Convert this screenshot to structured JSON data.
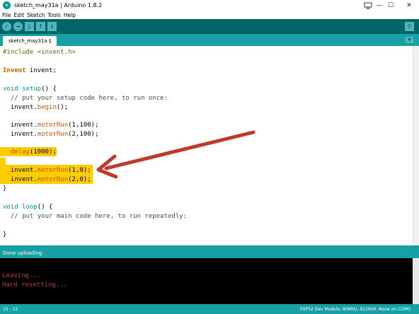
{
  "window": {
    "title": "sketch_may31a | Arduino 1.8.2",
    "minimize_glyph": "—",
    "maximize_glyph": "☐",
    "close_glyph": "✕",
    "logo_text": "∞"
  },
  "menu": [
    "File",
    "Edit",
    "Sketch",
    "Tools",
    "Help"
  ],
  "toolbar": {
    "verify_glyph": "✓",
    "upload_glyph": "→",
    "new_glyph": "▯",
    "open_glyph": "↑",
    "save_glyph": "↓",
    "serial_glyph": "⚲"
  },
  "tab": {
    "label": "sketch_may31a §",
    "menu_glyph": "▼"
  },
  "code": {
    "l1a": "#include ",
    "l1b": "<invent.h>",
    "l2a": "Invent",
    "l2b": " invent;",
    "l3a": "void",
    "l3b": " ",
    "l3c": "setup",
    "l3d": "() {",
    "l4": "  // put your setup code here, to run once:",
    "l5a": "  invent.",
    "l5b": "begin",
    "l5c": "();",
    "l6a": "  invent.",
    "l6b": "motorRun",
    "l6c": "(1,100);",
    "l7a": "  invent.",
    "l7b": "motorRun",
    "l7c": "(2,100);",
    "l8a": "  ",
    "l8b": "delay",
    "l8c": "(1000);",
    "l9a": "  invent.",
    "l9b": "motorRun",
    "l9c": "(1,0);",
    "l10a": "  invent.",
    "l10b": "motorRun",
    "l10c": "(2,0);",
    "l11": "}",
    "l12a": "void",
    "l12b": " ",
    "l12c": "loop",
    "l12d": "() {",
    "l13": "  // put your main code here, to run repeatedly:",
    "l14": "}"
  },
  "status": {
    "message": "Done uploading."
  },
  "console": {
    "line1": "Leaving...",
    "line2": "Hard resetting..."
  },
  "footer": {
    "line_info": "15 - 12",
    "board_info": "ESP32 Dev Module, 80MHz, 921600, None on COM3"
  },
  "colors": {
    "teal_dark": "#006468",
    "teal": "#17a1a5",
    "highlight": "#ffcc00",
    "annotation_arrow": "#c0392b"
  }
}
